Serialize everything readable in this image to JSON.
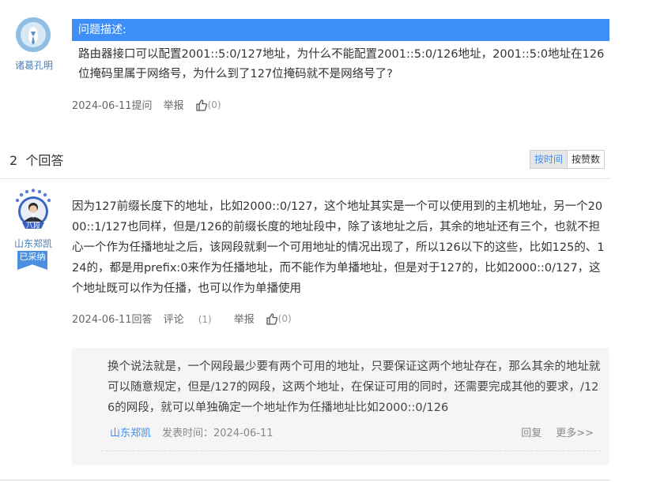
{
  "question": {
    "asker_name": "诸葛孔明",
    "header": "问题描述:",
    "body": "路由器接口可以配置2001::5:0/127地址，为什么不能配置2001::5:0/126地址，2001::5:0地址在126位掩码里属于网络号，为什么到了127位掩码就不是网络号了?",
    "date_label": "2024-06-11提问",
    "report_label": "举报",
    "like_count": "(0)"
  },
  "answers_section": {
    "title": "2  个回答",
    "sort_by_time": "按时间",
    "sort_by_likes": "按赞数"
  },
  "answer": {
    "author_name": "山东郑凯",
    "rank_badge": "八段",
    "adopted_label": "已采纳",
    "body": "因为127前缀长度下的地址，比如2000::0/127，这个地址其实是一个可以使用到的主机地址，另一个2000::1/127也同样，但是/126的前缀长度的地址段中，除了该地址之后，其余的地址还有三个，也就不担心一个作为任播地址之后，该网段就剩一个可用地址的情况出现了，所以126以下的这些，比如125的、124的，都是用prefix:0来作为任播地址，而不能作为单播地址，但是对于127的，比如2000::0/127，这个地址既可以作为任播，也可以作为单播使用",
    "date_label": "2024-06-11回答",
    "comment_label": "评论",
    "comment_count": "(1)",
    "report_label": "举报",
    "like_count": "(0)"
  },
  "comment": {
    "text": "换个说法就是，一个网段最少要有两个可用的地址，只要保证这两个地址存在，那么其余的地址就可以随意规定，但是/127的网段，这两个地址，在保证可用的同时，还需要完成其他的要求，/126的网段，就可以单独确定一个地址作为任播地址比如2000::0/126",
    "author": "山东郑凯",
    "time": "发表时间：2024-06-11",
    "reply_label": "回复",
    "more_label": "更多>>"
  },
  "colors": {
    "accent": "#3e8ef7",
    "link": "#4a7dbf",
    "comment_bg": "#f5f5f5"
  }
}
